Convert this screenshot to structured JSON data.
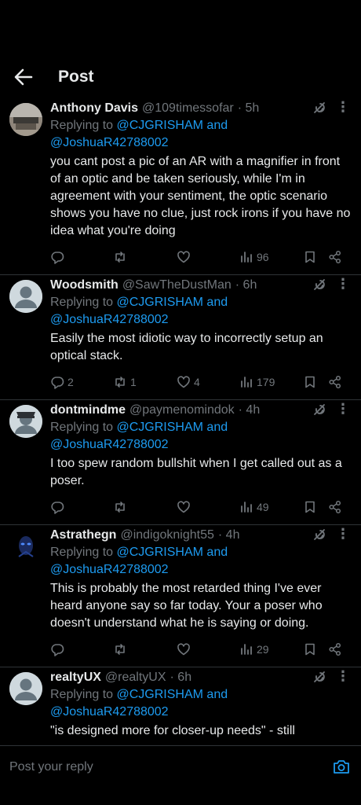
{
  "header": {
    "title": "Post",
    "back_icon": "arrow-left-icon"
  },
  "posts": [
    {
      "name": "Anthony Davis",
      "handle": "@109timessofar",
      "time": "· 5h",
      "reply_prefix": "Replying to ",
      "mention_1": "@CJGRISHAM",
      "and": " and",
      "mention_2": "@JoshuaR42788002",
      "text": "you cant post a pic of an AR with a magnifier in front of an optic and be taken seriously, while I'm in agreement with your sentiment, the optic scenario shows you have no clue,  just rock irons if you have no idea what you're doing",
      "replies": "",
      "reposts": "",
      "likes": "",
      "views": "96"
    },
    {
      "name": "Woodsmith",
      "handle": "@SawTheDustMan",
      "time": "· 6h",
      "reply_prefix": "Replying to ",
      "mention_1": "@CJGRISHAM",
      "and": " and",
      "mention_2": "@JoshuaR42788002",
      "text": "Easily the most idiotic way to incorrectly setup an optical stack.",
      "replies": "2",
      "reposts": "1",
      "likes": "4",
      "views": "179"
    },
    {
      "name": "dontmindme",
      "handle": "@paymenomindok",
      "time": "· 4h",
      "reply_prefix": "Replying to ",
      "mention_1": "@CJGRISHAM",
      "and": " and",
      "mention_2": "@JoshuaR42788002",
      "text": "I too spew random bullshit when I get called out as a poser.",
      "replies": "",
      "reposts": "",
      "likes": "",
      "views": "49"
    },
    {
      "name": "Astrathegn",
      "handle": "@indigoknight55",
      "time": "· 4h",
      "reply_prefix": "Replying to ",
      "mention_1": "@CJGRISHAM",
      "and": " and",
      "mention_2": "@JoshuaR42788002",
      "text": "This is probably the most retarded thing I've ever heard anyone say so far today. Your a poser who doesn't understand what he is saying or doing.",
      "replies": "",
      "reposts": "",
      "likes": "",
      "views": "29"
    },
    {
      "name": "realtyUX",
      "handle": "@realtyUX",
      "time": "· 6h",
      "reply_prefix": "Replying to ",
      "mention_1": "@CJGRISHAM",
      "and": " and",
      "mention_2": "@JoshuaR42788002",
      "text": "\"is designed more for closer-up needs\" - still"
    }
  ],
  "reply_bar": {
    "placeholder": "Post your reply",
    "camera_icon": "camera-icon"
  },
  "colors": {
    "background": "#000000",
    "text": "#e7e9ea",
    "muted": "#71767b",
    "accent": "#1d9bf0",
    "divider": "#2f3336"
  }
}
